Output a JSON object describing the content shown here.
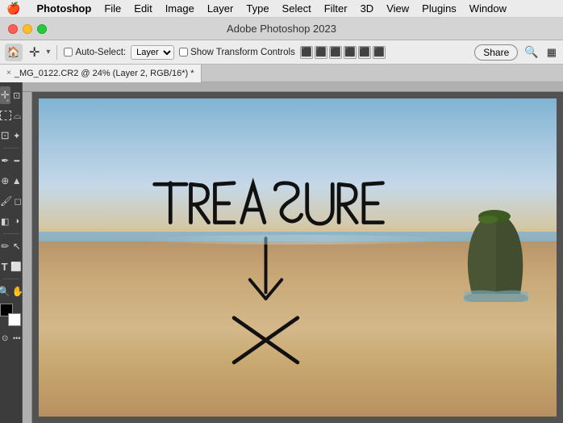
{
  "menubar": {
    "apple": "🍎",
    "items": [
      {
        "id": "photoshop",
        "label": "Photoshop",
        "active": true
      },
      {
        "id": "file",
        "label": "File"
      },
      {
        "id": "edit",
        "label": "Edit"
      },
      {
        "id": "image",
        "label": "Image"
      },
      {
        "id": "layer",
        "label": "Layer"
      },
      {
        "id": "type",
        "label": "Type"
      },
      {
        "id": "select",
        "label": "Select"
      },
      {
        "id": "filter",
        "label": "Filter"
      },
      {
        "id": "three-d",
        "label": "3D"
      },
      {
        "id": "view",
        "label": "View"
      },
      {
        "id": "plugins",
        "label": "Plugins"
      },
      {
        "id": "window",
        "label": "Window"
      }
    ]
  },
  "titlebar": {
    "title": "Adobe Photoshop 2023"
  },
  "optionsbar": {
    "auto_select_label": "Auto-Select:",
    "layer_option": "Layer",
    "show_transform_label": "Show Transform Controls",
    "share_label": "Share",
    "align_icons": [
      "⬛",
      "⬛",
      "⬛",
      "⬛",
      "⬛",
      "⬛"
    ]
  },
  "tab": {
    "close": "×",
    "title": "_MG_0122.CR2 @ 24% (Layer 2, RGB/16*) *"
  },
  "tools": [
    {
      "id": "move",
      "icon": "✛",
      "has_arrow": true
    },
    {
      "id": "marquee-rect",
      "icon": "⬚"
    },
    {
      "id": "marquee-ellipse",
      "icon": "◯"
    },
    {
      "id": "lasso",
      "icon": "⌓"
    },
    {
      "id": "lasso-poly",
      "icon": "⌔"
    },
    {
      "id": "magic-wand",
      "icon": "✦"
    },
    {
      "id": "crop",
      "icon": "⊡"
    },
    {
      "id": "eyedropper",
      "icon": "✒"
    },
    {
      "id": "ruler",
      "icon": "📏"
    },
    {
      "id": "healing",
      "icon": "⊕"
    },
    {
      "id": "brush",
      "icon": "🖌"
    },
    {
      "id": "stamp",
      "icon": "▲"
    },
    {
      "id": "eraser",
      "icon": "◻"
    },
    {
      "id": "gradient",
      "icon": "◧"
    },
    {
      "id": "dodge",
      "icon": "◑"
    },
    {
      "id": "pen",
      "icon": "✏"
    },
    {
      "id": "type",
      "icon": "T"
    },
    {
      "id": "path-select",
      "icon": "↖"
    },
    {
      "id": "rectangle",
      "icon": "⬜"
    },
    {
      "id": "hand",
      "icon": "✋"
    },
    {
      "id": "zoom",
      "icon": "🔍"
    },
    {
      "id": "more",
      "icon": "···"
    }
  ],
  "colors": {
    "foreground": "#000000",
    "background": "#ffffff",
    "accent": "#1473e6",
    "toolbar_bg": "#3c3c3c",
    "menubar_bg": "#ebebeb",
    "canvas_bg": "#525252"
  }
}
